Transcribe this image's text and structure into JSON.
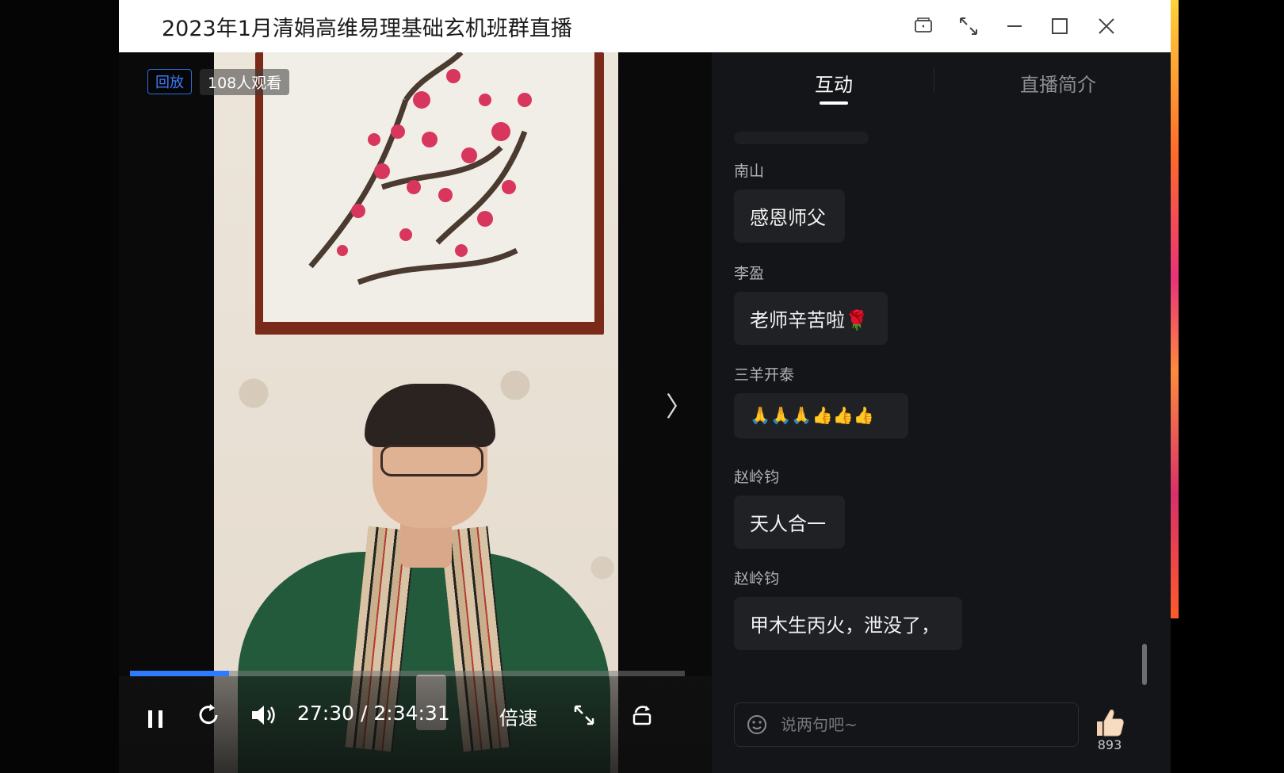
{
  "window": {
    "title": "2023年1月清娟高维易理基础玄机班群直播",
    "title_icons": [
      "screen-share-icon",
      "compact-icon",
      "minimize-icon",
      "maximize-icon",
      "close-icon"
    ]
  },
  "player": {
    "replay_badge": "回放",
    "viewers": "108人观看",
    "time": "27:30 / 2:34:31",
    "speed_label": "倍速",
    "progress_fraction": 0.178,
    "accent_color": "#2f7bff"
  },
  "panel": {
    "tabs": [
      {
        "label": "互动",
        "active": true
      },
      {
        "label": "直播简介",
        "active": false
      }
    ],
    "messages": [
      {
        "name": "南山",
        "text": "感恩师父"
      },
      {
        "name": "李盈",
        "text": "老师辛苦啦🌹"
      },
      {
        "name": "三羊开泰",
        "text": "🙏🙏🙏👍👍👍"
      },
      {
        "name": "赵岭钧",
        "text": "天人合一"
      },
      {
        "name": "赵岭钧",
        "text": "甲木生丙火，泄没了，"
      }
    ],
    "input_placeholder": "说两句吧~",
    "like_count": "893"
  }
}
